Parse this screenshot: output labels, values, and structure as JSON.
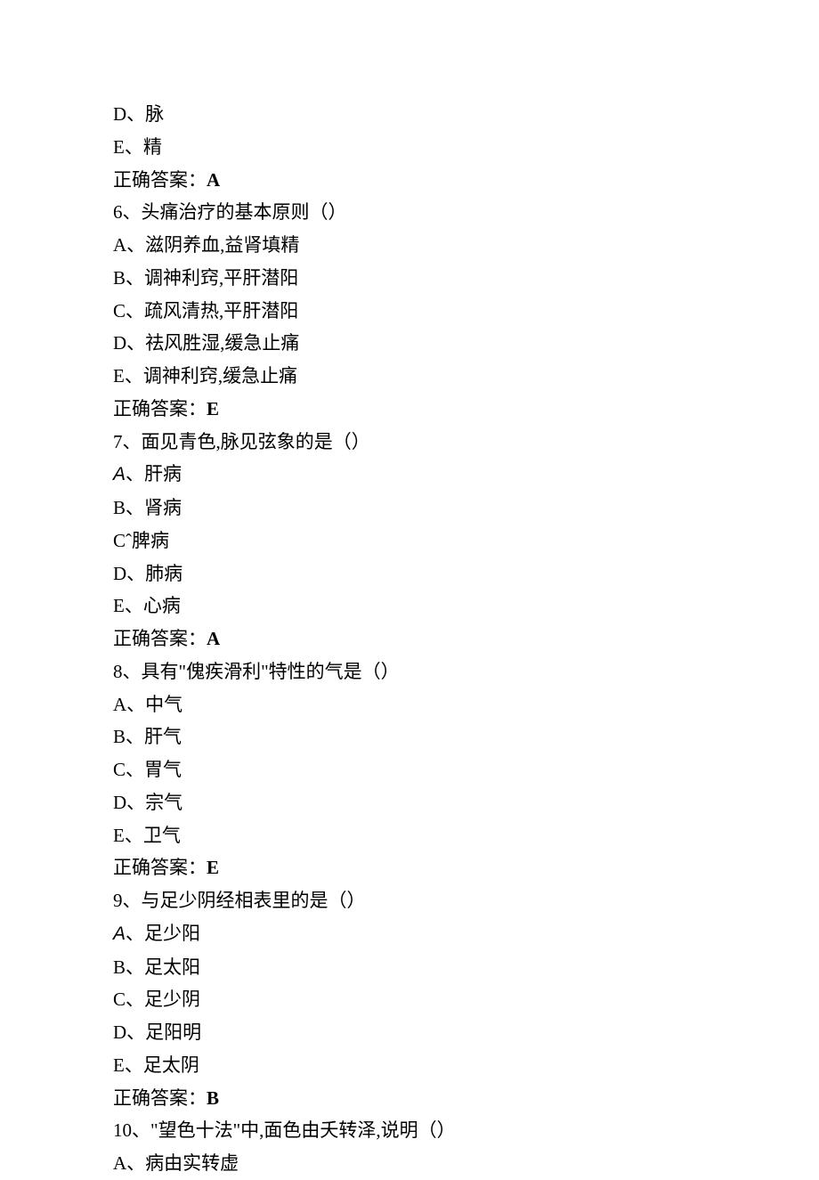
{
  "lines": [
    {
      "text": "D、脉"
    },
    {
      "text": "E、精"
    },
    {
      "prefix": "正确答案：",
      "answer": "A"
    },
    {
      "text": "6、头痛治疗的基本原则（）"
    },
    {
      "text": "A、滋阴养血,益肾填精"
    },
    {
      "text": "B、调神利窍,平肝潜阳"
    },
    {
      "text": "C、疏风清热,平肝潜阳"
    },
    {
      "text": "D、祛风胜湿,缓急止痛"
    },
    {
      "text": "E、调神利窍,缓急止痛"
    },
    {
      "prefix": "正确答案：",
      "answer": "E"
    },
    {
      "text": "7、面见青色,脉见弦象的是（）"
    },
    {
      "italic_prefix": "A",
      "suffix": "、肝病"
    },
    {
      "text": "B、肾病"
    },
    {
      "text": "Cˆ脾病"
    },
    {
      "text": "D、肺病"
    },
    {
      "text": "E、心病"
    },
    {
      "prefix": "正确答案：",
      "answer": "A"
    },
    {
      "text": "8、具有\"傀疾滑利\"特性的气是（）"
    },
    {
      "text": "A、中气"
    },
    {
      "text": "B、肝气"
    },
    {
      "text": "C、胃气"
    },
    {
      "text": "D、宗气"
    },
    {
      "text": "E、卫气"
    },
    {
      "prefix": "正确答案：",
      "answer": "E"
    },
    {
      "text": "9、与足少阴经相表里的是（）"
    },
    {
      "italic_prefix": "A",
      "suffix": "、足少阳"
    },
    {
      "text": "B、足太阳"
    },
    {
      "text": "C、足少阴"
    },
    {
      "text": "D、足阳明"
    },
    {
      "text": "E、足太阴"
    },
    {
      "prefix": "正确答案：",
      "answer": "B"
    },
    {
      "text": "10、\"望色十法\"中,面色由夭转泽,说明（）"
    },
    {
      "text": "A、病由实转虚"
    }
  ]
}
